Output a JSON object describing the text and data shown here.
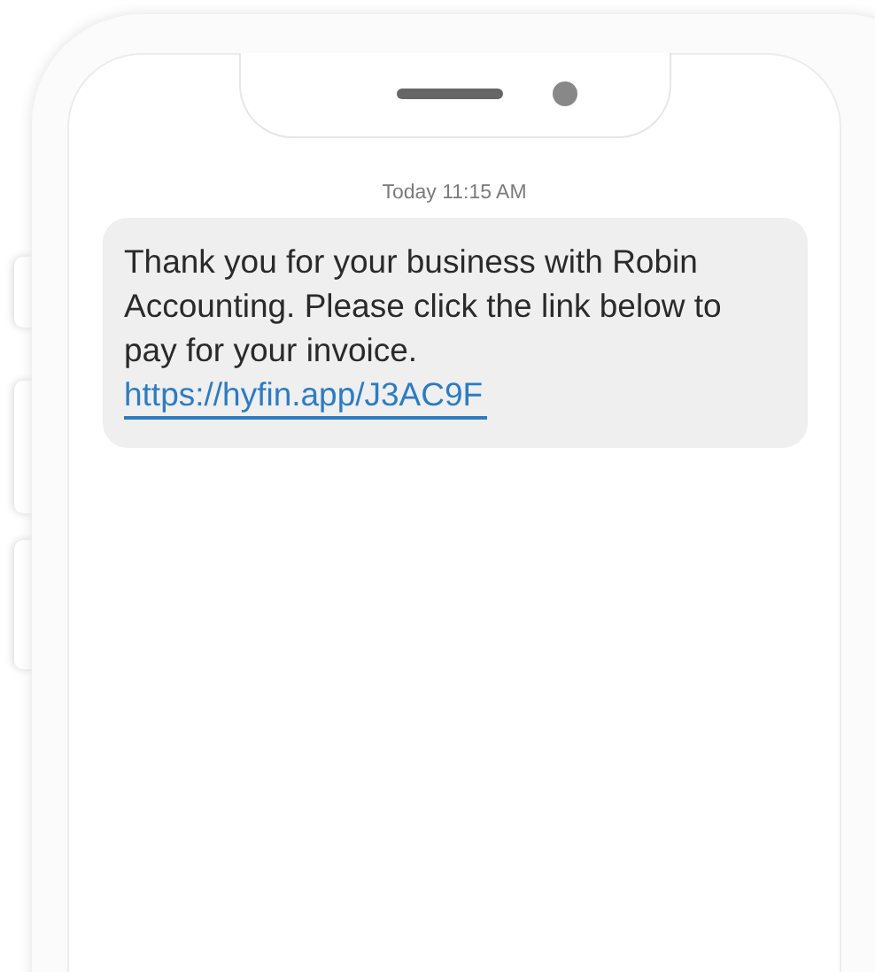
{
  "message": {
    "timestamp": "Today 11:15 AM",
    "text": "Thank you for your business with Robin Accounting. Please click the link below to pay for your invoice.",
    "link": "https://hyfin.app/J3AC9F"
  }
}
